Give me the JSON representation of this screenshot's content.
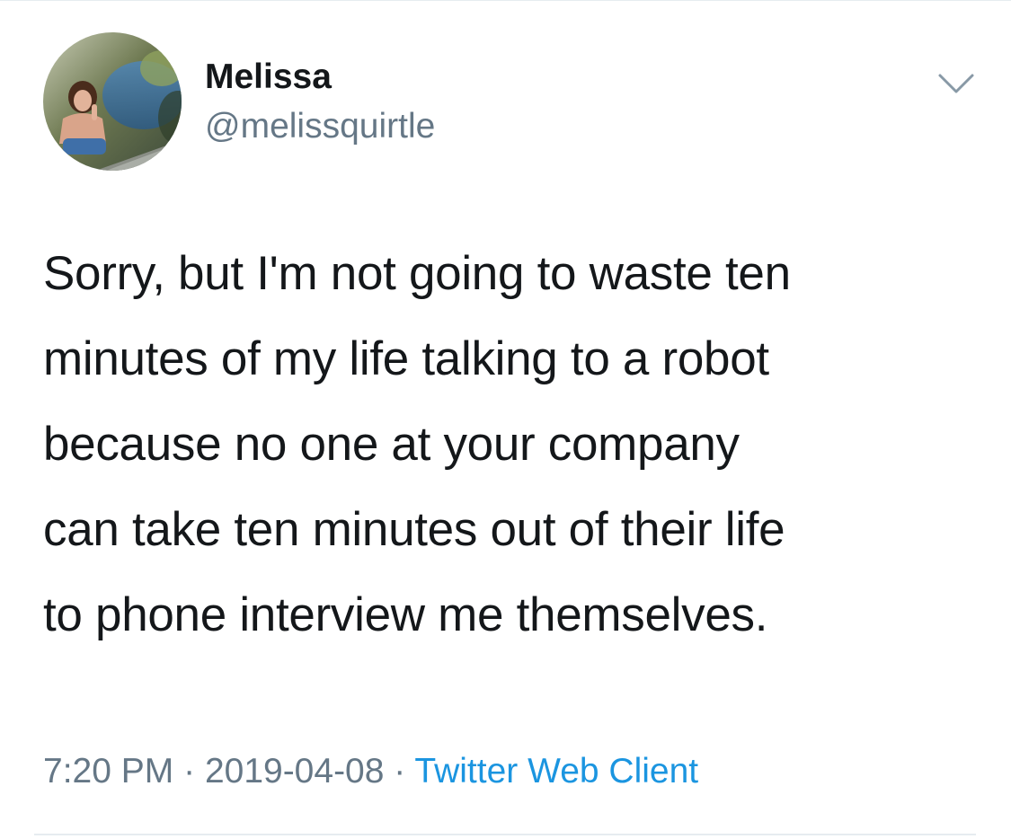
{
  "user": {
    "display_name": "Melissa",
    "handle": "@melissquirtle"
  },
  "tweet": {
    "lines": [
      "Sorry, but I'm not going to waste ten",
      "minutes of my life talking to a robot",
      "because no one at your company",
      "can take ten minutes out of their life",
      "to phone interview me themselves."
    ],
    "time": "7:20 PM",
    "separator": "·",
    "date": "2019-04-08",
    "source": "Twitter Web Client"
  },
  "icons": {
    "menu": "chevron-down-icon",
    "avatar": "profile-photo"
  },
  "colors": {
    "text_primary": "#14171a",
    "text_secondary": "#657786",
    "link": "#1b95e0",
    "divider": "#e6ecf0"
  }
}
